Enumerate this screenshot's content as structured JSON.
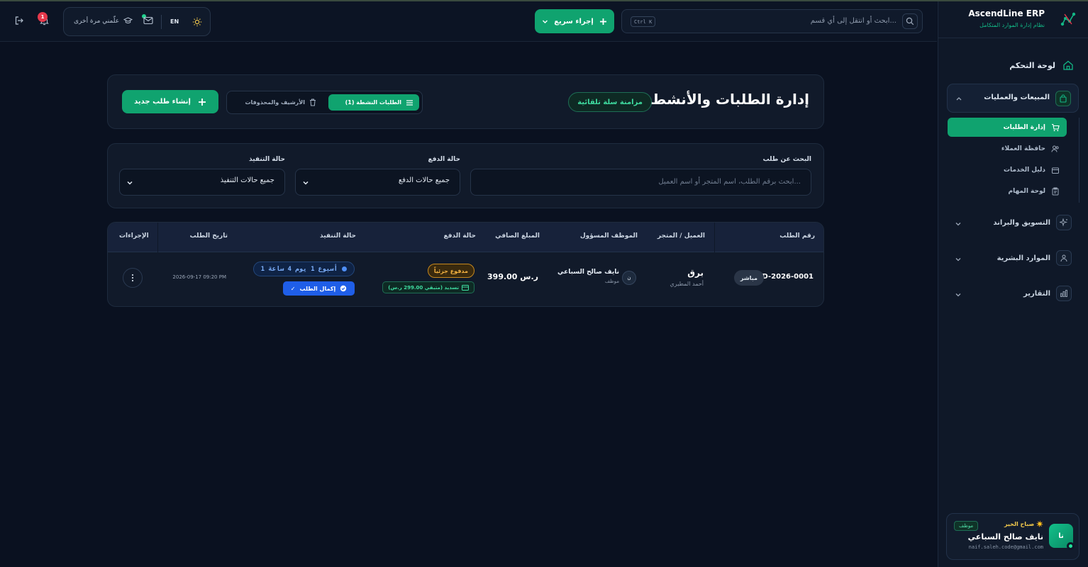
{
  "brand": {
    "name": "AscendLine ERP",
    "subtitle": "نظام إدارة الموارد المتكامل"
  },
  "header": {
    "search_placeholder": "ابحث أو انتقل إلى أي قسم...",
    "shortcut": "Ctrl K",
    "quick_action": "إجراء سريع",
    "teach_again": "علّمني مرة أخرى",
    "language": "EN",
    "notification_count": "1"
  },
  "sidebar": {
    "dashboard": "لوحة التحكم",
    "sales_group": "المبيعات والعمليات",
    "sub_items": [
      "إدارة الطلبات",
      "حافظة العملاء",
      "دليل الخدمات",
      "لوحة المهام"
    ],
    "marketing_group": "التسويق والبراند",
    "hr_group": "الموارد البشرية",
    "reports_group": "التقارير"
  },
  "user": {
    "greeting": "صباح الخير ☀️",
    "role": "موظف",
    "name": "نايف صالح السباعي",
    "email": "naif.saleh.code@gmail.com",
    "initials": "نا"
  },
  "page": {
    "title": "إدارة الطلبات والأنشطة",
    "sync_badge": "مزامنة سلة تلقائية",
    "tab_active": "الطلبات النشطة (1)",
    "tab_archive": "الأرشيف والمحذوفات",
    "create_button": "إنشاء طلب جديد"
  },
  "filters": {
    "search_label": "البحث عن طلب",
    "search_placeholder": "ابحث برقم الطلب، اسم المتجر أو اسم العميل...",
    "payment_label": "حالة الدفع",
    "payment_value": "جميع حالات الدفع",
    "exec_label": "حالة التنفيذ",
    "exec_value": "جميع حالات التنفيذ"
  },
  "table": {
    "columns": [
      "رقم الطلب",
      "العميل / المتجر",
      "الموظف المسؤول",
      "المبلغ الصافي",
      "حالة الدفع",
      "حالة التنفيذ",
      "تاريخ الطلب",
      "الإجراءات"
    ],
    "rows": [
      {
        "order_no": "ORD-2026-0001",
        "channel": "مباشر",
        "customer": "برق",
        "customer_sub": "أحمد المطيري",
        "employee_initial": "ن",
        "employee": "نايف صالح السباعي",
        "employee_role": "موظف",
        "amount": "399.00 ر.س",
        "payment_status": "مدفوع جزئياً",
        "settle": "تسديد (متبقي 299.00 ر.س)",
        "duration": "1 أسبوع 1 يوم 4 ساعة",
        "complete": "إكمال الطلب",
        "date": "2026-09-17 09:20 PM"
      }
    ]
  },
  "colors": {
    "accent": "#10a36f",
    "background": "#0a1120",
    "warning": "#f5b342",
    "primary_blue": "#1f5ee8"
  }
}
